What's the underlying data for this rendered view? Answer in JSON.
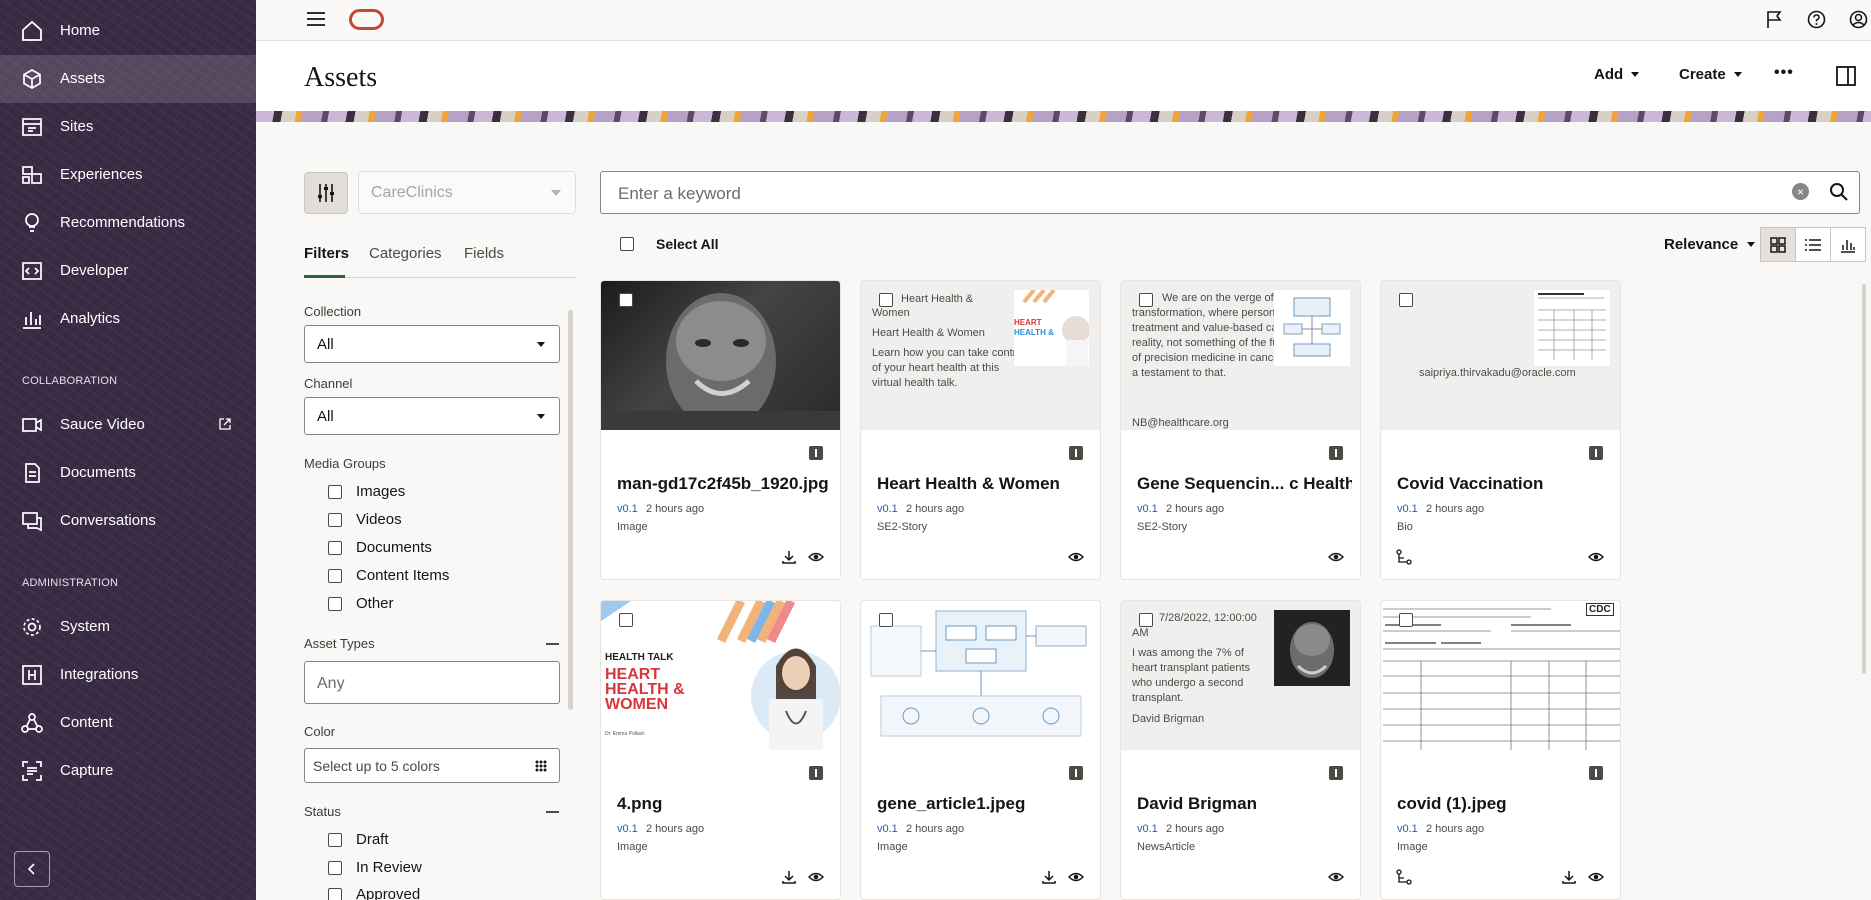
{
  "sidebar": {
    "items": [
      {
        "label": "Home",
        "icon": "home-icon"
      },
      {
        "label": "Assets",
        "icon": "cube-icon"
      },
      {
        "label": "Sites",
        "icon": "sites-icon"
      },
      {
        "label": "Experiences",
        "icon": "experiences-icon"
      },
      {
        "label": "Recommendations",
        "icon": "lightbulb-icon"
      },
      {
        "label": "Developer",
        "icon": "code-icon"
      },
      {
        "label": "Analytics",
        "icon": "analytics-icon"
      }
    ],
    "collab_heading": "COLLABORATION",
    "collab_items": [
      {
        "label": "Sauce Video",
        "icon": "video-icon"
      },
      {
        "label": "Documents",
        "icon": "documents-icon"
      },
      {
        "label": "Conversations",
        "icon": "conversations-icon"
      }
    ],
    "admin_heading": "ADMINISTRATION",
    "admin_items": [
      {
        "label": "System",
        "icon": "gear-icon"
      },
      {
        "label": "Integrations",
        "icon": "integrations-icon"
      },
      {
        "label": "Content",
        "icon": "content-icon"
      },
      {
        "label": "Capture",
        "icon": "capture-icon"
      }
    ]
  },
  "header": {
    "title": "Assets",
    "add_label": "Add",
    "create_label": "Create",
    "more_label": "•••"
  },
  "filters": {
    "repository": "CareClinics",
    "tabs": [
      "Filters",
      "Categories",
      "Fields"
    ],
    "collection_label": "Collection",
    "collection_value": "All",
    "channel_label": "Channel",
    "channel_value": "All",
    "media_groups_label": "Media Groups",
    "media_groups": [
      "Images",
      "Videos",
      "Documents",
      "Content Items",
      "Other"
    ],
    "asset_types_label": "Asset Types",
    "asset_types_placeholder": "Any",
    "color_label": "Color",
    "color_placeholder": "Select up to 5 colors",
    "status_label": "Status",
    "statuses": [
      "Draft",
      "In Review",
      "Approved"
    ]
  },
  "search": {
    "placeholder": "Enter a keyword",
    "select_all": "Select All",
    "sort": "Relevance"
  },
  "cards": [
    {
      "title": "man-gd17c2f45b_1920.jpg",
      "version": "v0.1",
      "time": "2 hours ago",
      "type": "Image"
    },
    {
      "title": "Heart Health & Women",
      "version": "v0.1",
      "time": "2 hours ago",
      "type": "SE2-Story",
      "thumb_lines": [
        "Heart Health &",
        "Women",
        "Heart Health & Women",
        "Learn how you can take control of your heart health at this virtual health talk."
      ]
    },
    {
      "title": "Gene Sequencin... c Health",
      "version": "v0.1",
      "time": "2 hours ago",
      "type": "SE2-Story",
      "thumb_text": "We are on the verge of a healthcare transformation, where personalized treatment and value-based care are a reality, not something of the future. The use of precision medicine in cancer treatment is a testament to that.",
      "thumb_email": "NB@healthcare.org"
    },
    {
      "title": "Covid Vaccination",
      "version": "v0.1",
      "time": "2 hours ago",
      "type": "Bio",
      "thumb_email": "saipriya.thirvakadu@oracle.com"
    },
    {
      "title": "4.png",
      "version": "v0.1",
      "time": "2 hours ago",
      "type": "Image",
      "thumb_kicker": "HEALTH TALK",
      "thumb_headline": "HEART HEALTH & WOMEN",
      "thumb_byline": "Dr. Emma Pollack"
    },
    {
      "title": "gene_article1.jpeg",
      "version": "v0.1",
      "time": "2 hours ago",
      "type": "Image"
    },
    {
      "title": "David Brigman",
      "version": "v0.1",
      "time": "2 hours ago",
      "type": "NewsArticle",
      "thumb_date": "7/28/2022, 12:00:00 AM",
      "thumb_text": "I was among the 7% of heart transplant patients who undergo a second transplant.",
      "thumb_author": "David Brigman"
    },
    {
      "title": "covid (1).jpeg",
      "version": "v0.1",
      "time": "2 hours ago",
      "type": "Image",
      "thumb_logo": "CDC"
    }
  ],
  "colors": {
    "sidebar": "#3a2b45",
    "accent": "#2b6242",
    "oracle_red": "#c74634",
    "link": "#2a5ea8"
  }
}
